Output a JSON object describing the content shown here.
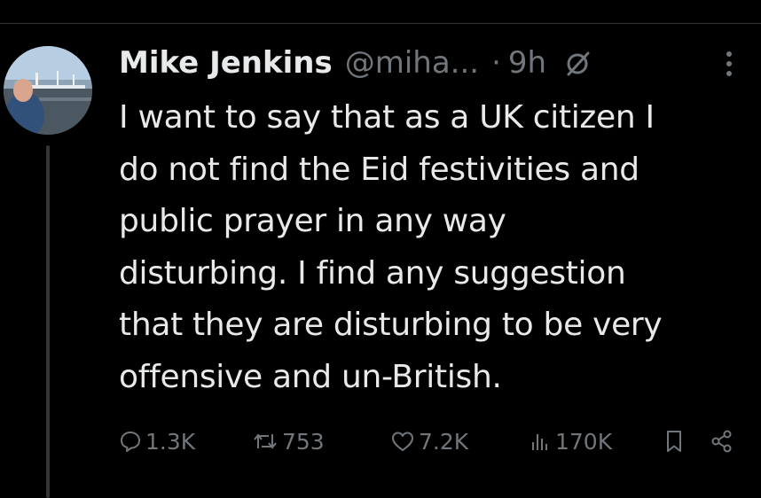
{
  "post": {
    "author_name": "Mike Jenkins",
    "handle": "@miha...",
    "separator": "·",
    "time": "9h",
    "text": "I want to say that as a UK citizen I\ndo not find the Eid festivities and\npublic prayer in any way\ndisturbing. I find any suggestion\nthat they are disturbing to be very\noffensive and un-British.",
    "stats": {
      "replies": "1.3K",
      "reposts": "753",
      "likes": "7.2K",
      "views": "170K"
    }
  },
  "icons": {
    "verified": "no-entry-circle-icon",
    "more": "more-vertical-icon",
    "reply": "speech-bubble-icon",
    "repost": "repost-arrows-icon",
    "like": "heart-icon",
    "views": "bar-chart-icon",
    "bookmark": "bookmark-icon",
    "share": "share-icon"
  },
  "colors": {
    "background": "#000000",
    "text_primary": "#e7e9ea",
    "text_secondary": "#71767b",
    "divider": "#2f3336",
    "thread_line": "#333639"
  }
}
